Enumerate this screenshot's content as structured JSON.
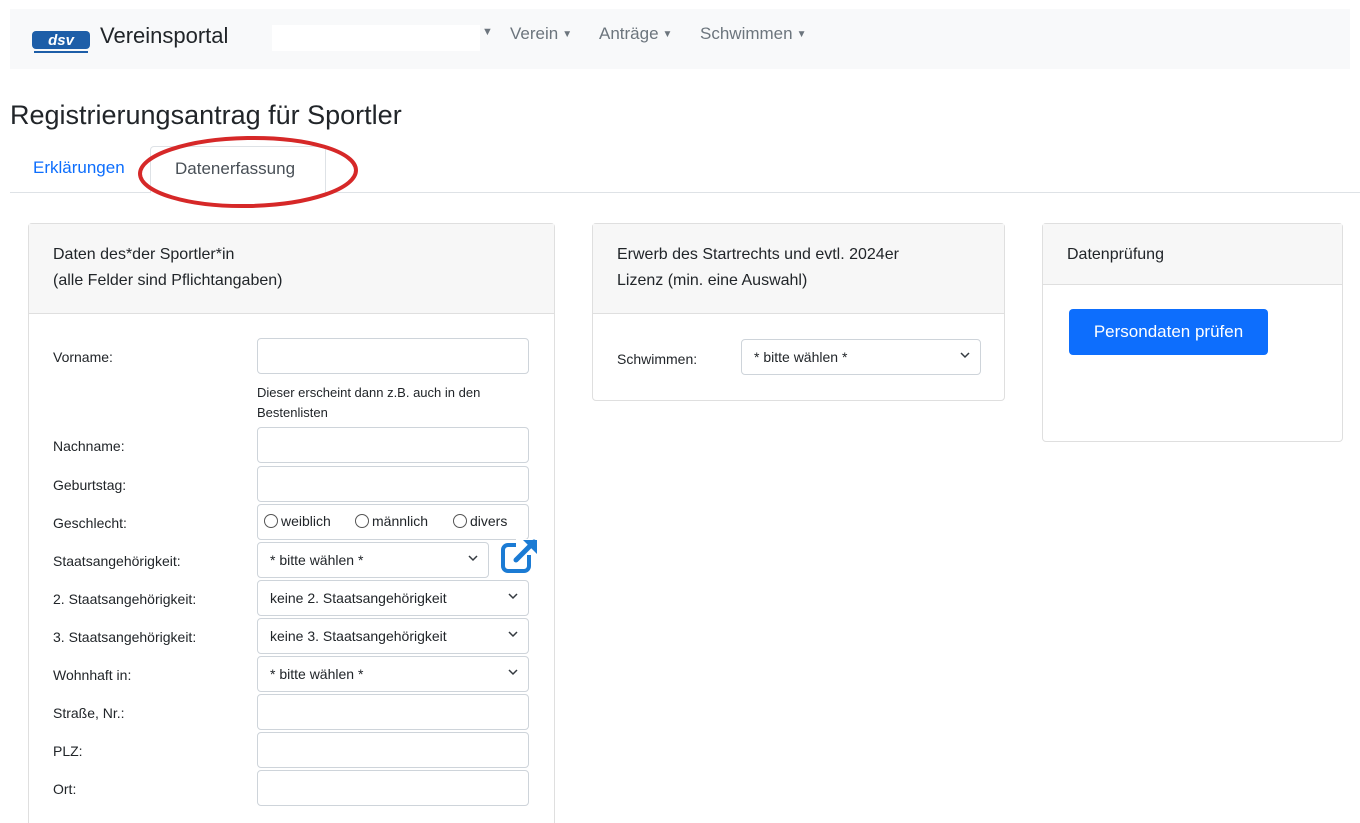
{
  "navbar": {
    "brand": "Vereinsportal",
    "items": [
      {
        "label": "Verein"
      },
      {
        "label": "Anträge"
      },
      {
        "label": "Schwimmen"
      }
    ]
  },
  "page": {
    "title": "Registrierungsantrag für Sportler"
  },
  "tabs": [
    {
      "label": "Erklärungen",
      "active": false
    },
    {
      "label": "Datenerfassung",
      "active": true
    }
  ],
  "athlete_card": {
    "header_line1": "Daten des*der Sportler*in",
    "header_line2": "(alle Felder sind Pflichtangaben)",
    "fields": {
      "vorname": {
        "label": "Vorname:",
        "value": ""
      },
      "vorname_help": "Dieser erscheint dann z.B. auch in den Bestenlisten",
      "nachname": {
        "label": "Nachname:",
        "value": ""
      },
      "geburtstag": {
        "label": "Geburtstag:",
        "value": ""
      },
      "geschlecht": {
        "label": "Geschlecht:",
        "options": [
          "weiblich",
          "männlich",
          "divers"
        ]
      },
      "staat1": {
        "label": "Staatsangehörigkeit:",
        "selected": "* bitte wählen *"
      },
      "staat2": {
        "label": "2. Staatsangehörigkeit:",
        "selected": "keine 2. Staatsangehörigkeit"
      },
      "staat3": {
        "label": "3. Staatsangehörigkeit:",
        "selected": "keine 3. Staatsangehörigkeit"
      },
      "wohnhaft": {
        "label": "Wohnhaft in:",
        "selected": "* bitte wählen *"
      },
      "strasse": {
        "label": "Straße, Nr.:",
        "value": ""
      },
      "plz": {
        "label": "PLZ:",
        "value": ""
      },
      "ort": {
        "label": "Ort:",
        "value": ""
      }
    }
  },
  "license_card": {
    "header_line1": "Erwerb des Startrechts und evtl. 2024er",
    "header_line2": "Lizenz (min. eine Auswahl)",
    "schwimmen": {
      "label": "Schwimmen:",
      "selected": "* bitte wählen *"
    }
  },
  "check_card": {
    "header": "Datenprüfung",
    "button_label": "Persondaten prüfen"
  },
  "colors": {
    "primary": "#0d6efd",
    "annotation": "#d62828",
    "logo_blue": "#1d5ea8"
  },
  "icons": {
    "external_link": "external-link-icon",
    "select_chevron": "chevron-down-icon",
    "nav_caret": "caret-down-icon"
  }
}
